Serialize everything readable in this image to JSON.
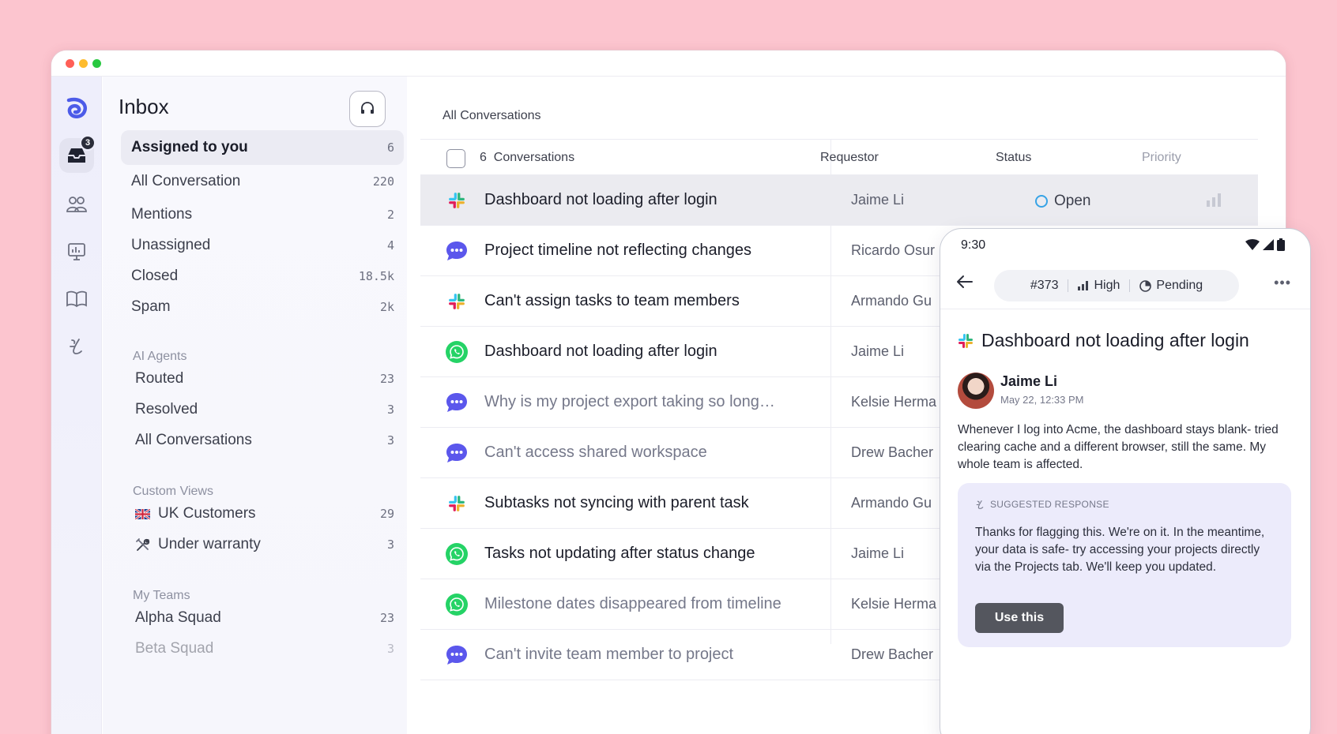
{
  "sidebar": {
    "title": "Inbox",
    "rail_badge": "3",
    "nav": [
      {
        "label": "Assigned to you",
        "count": "6"
      },
      {
        "label": "All Conversation",
        "count": "220"
      },
      {
        "label": "Mentions",
        "count": "2"
      },
      {
        "label": "Unassigned",
        "count": "4"
      },
      {
        "label": "Closed",
        "count": "18.5k"
      },
      {
        "label": "Spam",
        "count": "2k"
      }
    ],
    "ai_agents": {
      "label": "AI Agents",
      "items": [
        {
          "label": "Routed",
          "count": "23"
        },
        {
          "label": "Resolved",
          "count": "3"
        },
        {
          "label": "All Conversations",
          "count": "3"
        }
      ]
    },
    "custom_views": {
      "label": "Custom Views",
      "items": [
        {
          "label": "UK Customers",
          "count": "29",
          "icon": "uk-flag-icon"
        },
        {
          "label": "Under warranty",
          "count": "3",
          "icon": "tools-icon"
        }
      ]
    },
    "my_teams": {
      "label": "My Teams",
      "items": [
        {
          "label": "Alpha Squad",
          "count": "23"
        },
        {
          "label": "Beta Squad",
          "count": "3"
        }
      ]
    }
  },
  "main": {
    "header": "All Conversations",
    "columns": {
      "count": "6",
      "conversations": "Conversations",
      "requestor": "Requestor",
      "status": "Status",
      "priority": "Priority"
    },
    "rows": [
      {
        "channel": "slack",
        "title": "Dashboard not loading after login",
        "requestor": "Jaime Li",
        "status": "Open",
        "unread": true
      },
      {
        "channel": "chat",
        "title": "Project timeline not reflecting changes",
        "requestor": "Ricardo Osur",
        "unread": true
      },
      {
        "channel": "slack",
        "title": "Can't assign tasks to team members",
        "requestor": "Armando Gu",
        "unread": true
      },
      {
        "channel": "whatsapp",
        "title": "Dashboard not loading after login",
        "requestor": "Jaime Li",
        "unread": true
      },
      {
        "channel": "chat",
        "title": "Why is my project export taking so long…",
        "requestor": "Kelsie Herma",
        "unread": false
      },
      {
        "channel": "chat",
        "title": "Can't access shared workspace",
        "requestor": "Drew Bacher",
        "unread": false
      },
      {
        "channel": "slack",
        "title": "Subtasks not syncing with parent task",
        "requestor": "Armando Gu",
        "unread": true
      },
      {
        "channel": "whatsapp",
        "title": "Tasks not updating after status change",
        "requestor": "Jaime Li",
        "unread": true
      },
      {
        "channel": "whatsapp",
        "title": "Milestone dates disappeared from timeline",
        "requestor": "Kelsie Herma",
        "unread": false
      },
      {
        "channel": "chat",
        "title": "Can't invite team member to project",
        "requestor": "Drew Bacher",
        "unread": false
      }
    ]
  },
  "phone": {
    "time": "9:30",
    "ticket": "#373",
    "priority": "High",
    "status": "Pending",
    "title": "Dashboard not loading after login",
    "author": "Jaime Li",
    "date": "May 22, 12:33 PM",
    "message": "Whenever I log into Acme, the dashboard stays blank- tried clearing cache and a different browser, still the same. My whole team is affected.",
    "suggested_label": "SUGGESTED RESPONSE",
    "suggested_text": "Thanks for flagging this. We're on it. In the meantime, your data is safe- try accessing your projects directly via the Projects tab. We'll keep you updated.",
    "use_button": "Use this"
  },
  "colors": {
    "background": "#fcc5cf",
    "accent": "#5a5ff0",
    "slack": [
      "#e01e5a",
      "#36c5f0",
      "#2eb67d",
      "#ecb22e"
    ],
    "whatsapp": "#25d366",
    "chat": "#5b57ec",
    "status_open": "#37a3e6"
  }
}
